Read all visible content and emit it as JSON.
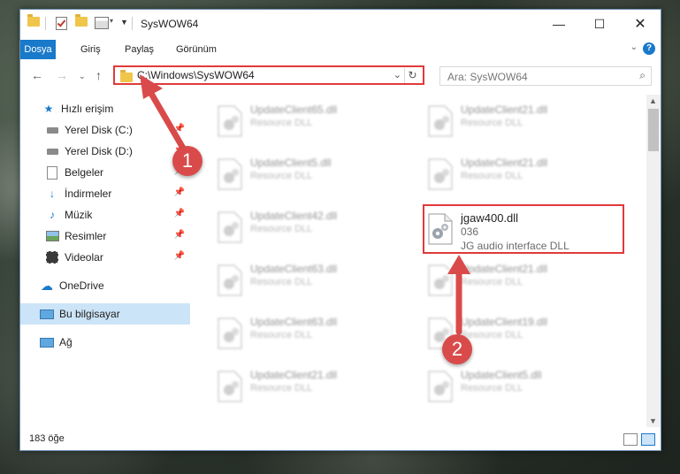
{
  "window": {
    "title": "SysWOW64"
  },
  "ribbon": {
    "tabs": [
      "Dosya",
      "Giriş",
      "Paylaş",
      "Görünüm"
    ]
  },
  "navbar": {
    "path": "C:\\Windows\\SysWOW64",
    "search_placeholder": "Ara: SysWOW64"
  },
  "sidebar": {
    "items": [
      {
        "label": "Hızlı erişim",
        "icon": "star-icon",
        "pinned": false
      },
      {
        "label": "Yerel Disk (C:)",
        "icon": "drive-icon",
        "pinned": true
      },
      {
        "label": "Yerel Disk (D:)",
        "icon": "drive-icon",
        "pinned": true
      },
      {
        "label": "Belgeler",
        "icon": "documents-icon",
        "pinned": true
      },
      {
        "label": "İndirmeler",
        "icon": "download-icon",
        "pinned": true
      },
      {
        "label": "Müzik",
        "icon": "music-icon",
        "pinned": true
      },
      {
        "label": "Resimler",
        "icon": "pictures-icon",
        "pinned": true
      },
      {
        "label": "Videolar",
        "icon": "videos-icon",
        "pinned": true
      },
      {
        "label": "OneDrive",
        "icon": "cloud-icon",
        "pinned": false
      },
      {
        "label": "Bu bilgisayar",
        "icon": "computer-icon",
        "pinned": false,
        "selected": true
      },
      {
        "label": "Ağ",
        "icon": "network-icon",
        "pinned": false
      }
    ]
  },
  "files": {
    "left": [
      {
        "name": "UpdateClient65.dll",
        "type": "Resource DLL"
      },
      {
        "name": "UpdateClient5.dll",
        "type": "Resource DLL"
      },
      {
        "name": "UpdateClient42.dll",
        "type": "Resource DLL"
      },
      {
        "name": "UpdateClient63.dll",
        "type": "Resource DLL"
      },
      {
        "name": "UpdateClient63.dll",
        "type": "Resource DLL"
      },
      {
        "name": "UpdateClient21.dll",
        "type": "Resource DLL"
      }
    ],
    "right": [
      {
        "name": "UpdateClient21.dll",
        "type": "Resource DLL"
      },
      {
        "name": "UpdateClient21.dll",
        "type": "Resource DLL"
      },
      {
        "name": "jgaw400.dll",
        "type": "036",
        "desc": "JG audio interface DLL",
        "highlighted": true
      },
      {
        "name": "UpdateClient21.dll",
        "type": "Resource DLL"
      },
      {
        "name": "UpdateClient19.dll",
        "type": "Resource DLL"
      },
      {
        "name": "UpdateClient5.dll",
        "type": "Resource DLL"
      }
    ]
  },
  "status": {
    "count": "183 öğe"
  },
  "callouts": {
    "one": "1",
    "two": "2"
  },
  "colors": {
    "accent": "#1979ca",
    "highlight": "#e03a3a",
    "callout": "#d94b4b",
    "selected": "#cce4f7"
  }
}
